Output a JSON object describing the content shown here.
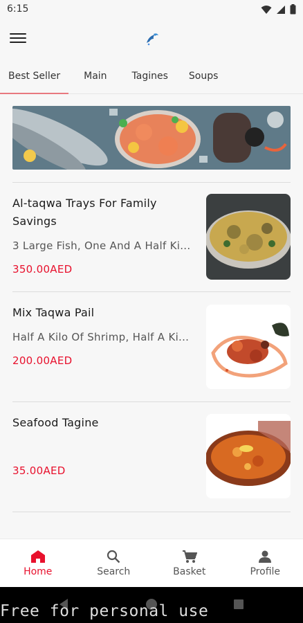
{
  "status": {
    "time": "6:15"
  },
  "tabs": [
    {
      "label": "Best Seller"
    },
    {
      "label": "Main"
    },
    {
      "label": "Tagines"
    },
    {
      "label": "Soups"
    }
  ],
  "items": [
    {
      "title": "Al-taqwa Trays For Family Savings",
      "desc": "3 Large Fish, One And A Half Ki...",
      "price": "350.00AED"
    },
    {
      "title": "Mix Taqwa Pail",
      "desc": "Half A Kilo Of Shrimp, Half A Ki...",
      "price": "200.00AED"
    },
    {
      "title": "Seafood Tagine",
      "desc": "",
      "price": "35.00AED"
    }
  ],
  "nav": [
    {
      "label": "Home"
    },
    {
      "label": "Search"
    },
    {
      "label": "Basket"
    },
    {
      "label": "Profile"
    }
  ],
  "watermark": "Free for personal use",
  "colors": {
    "accent": "#e8112d",
    "tab_underline": "#e8787f"
  }
}
